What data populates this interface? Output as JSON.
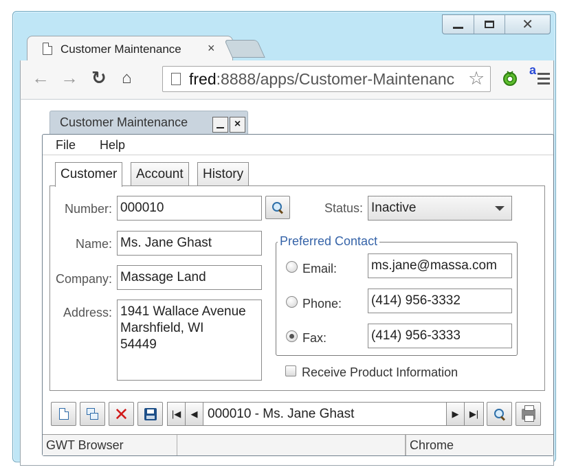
{
  "browser": {
    "tab_title": "Customer Maintenance",
    "tab_close": "×",
    "url_host": "fred",
    "url_rest": ":8888/apps/Customer-Maintenanc",
    "ext_badge": "a"
  },
  "window_controls": {
    "close_glyph": "✕"
  },
  "app_window": {
    "title": "Customer Maintenance",
    "close_glyph": "×"
  },
  "menu": {
    "file": "File",
    "help": "Help"
  },
  "tabs": {
    "customer": "Customer",
    "account": "Account",
    "history": "History"
  },
  "form": {
    "number_label": "Number:",
    "number_value": "000010",
    "name_label": "Name:",
    "name_value": "Ms. Jane Ghast",
    "company_label": "Company:",
    "company_value": "Massage Land",
    "address_label": "Address:",
    "address_lines": [
      "1941 Wallace Avenue",
      "Marshfield, WI",
      "54449"
    ],
    "status_label": "Status:",
    "status_value": "Inactive"
  },
  "preferred_contact": {
    "legend": "Preferred Contact",
    "email_label": "Email:",
    "email_value": "ms.jane@massa.com",
    "phone_label": "Phone:",
    "phone_value": "(414) 956-3332",
    "fax_label": "Fax:",
    "fax_value": "(414) 956-3333",
    "selected": "fax"
  },
  "receive_info_label": "Receive Product Information",
  "navigator": {
    "record_text": "000010 - Ms. Jane Ghast",
    "first_glyph": "|◀",
    "prev_glyph": "◀",
    "next_glyph": "▶",
    "last_glyph": "▶|"
  },
  "statusbar": {
    "left": "GWT Browser",
    "middle": "",
    "right": "Chrome"
  },
  "colors": {
    "frame": "#bfe6f6",
    "legend": "#3563a8",
    "delete": "#d11a1a"
  }
}
